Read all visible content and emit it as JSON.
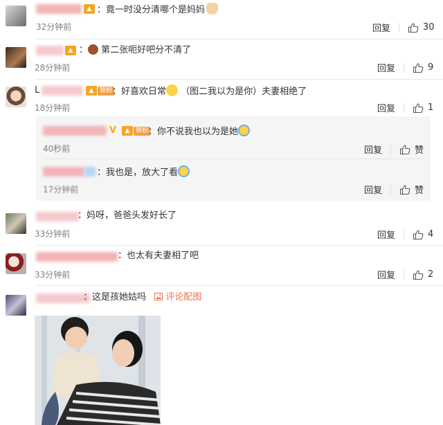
{
  "comments": [
    {
      "text": "竟一时没分清哪个是妈妈",
      "time": "32分钟前",
      "reply_label": "回复",
      "likes": "30"
    },
    {
      "text": "第二张呃好吧分不清了",
      "time": "28分钟前",
      "reply_label": "回复",
      "likes": "9"
    },
    {
      "username_initial": "L",
      "fan_badge": "铁粉",
      "text_prefix": "：好喜欢日常",
      "text_suffix": "（图二我以为是你）夫妻相绝了",
      "time": "18分钟前",
      "reply_label": "回复",
      "likes": "1"
    },
    {
      "text": "：妈呀，爸爸头发好长了",
      "time": "33分钟前",
      "reply_label": "回复",
      "likes": "4"
    },
    {
      "text": "：也太有夫妻相了吧",
      "time": "33分钟前",
      "reply_label": "回复",
      "likes": "2"
    },
    {
      "text": "：这是孩她姑吗",
      "image_link": "评论配图"
    }
  ],
  "replies": [
    {
      "username_suffix": "V",
      "fan_badge": "铁粉",
      "text": "：你不说我也以为是她",
      "time": "40秒前",
      "reply_label": "回复",
      "like_label": "赞"
    },
    {
      "text": "：我也是，放大了看",
      "time": "17分钟前",
      "reply_label": "回复",
      "like_label": "赞"
    }
  ],
  "icons": {
    "thumb": "thumbs-up-icon",
    "vip": "vip-crown-icon",
    "image": "image-icon"
  },
  "colors": {
    "link": "#eb7350",
    "subtle": "#808080",
    "reply_bg": "#f5f5f5"
  }
}
